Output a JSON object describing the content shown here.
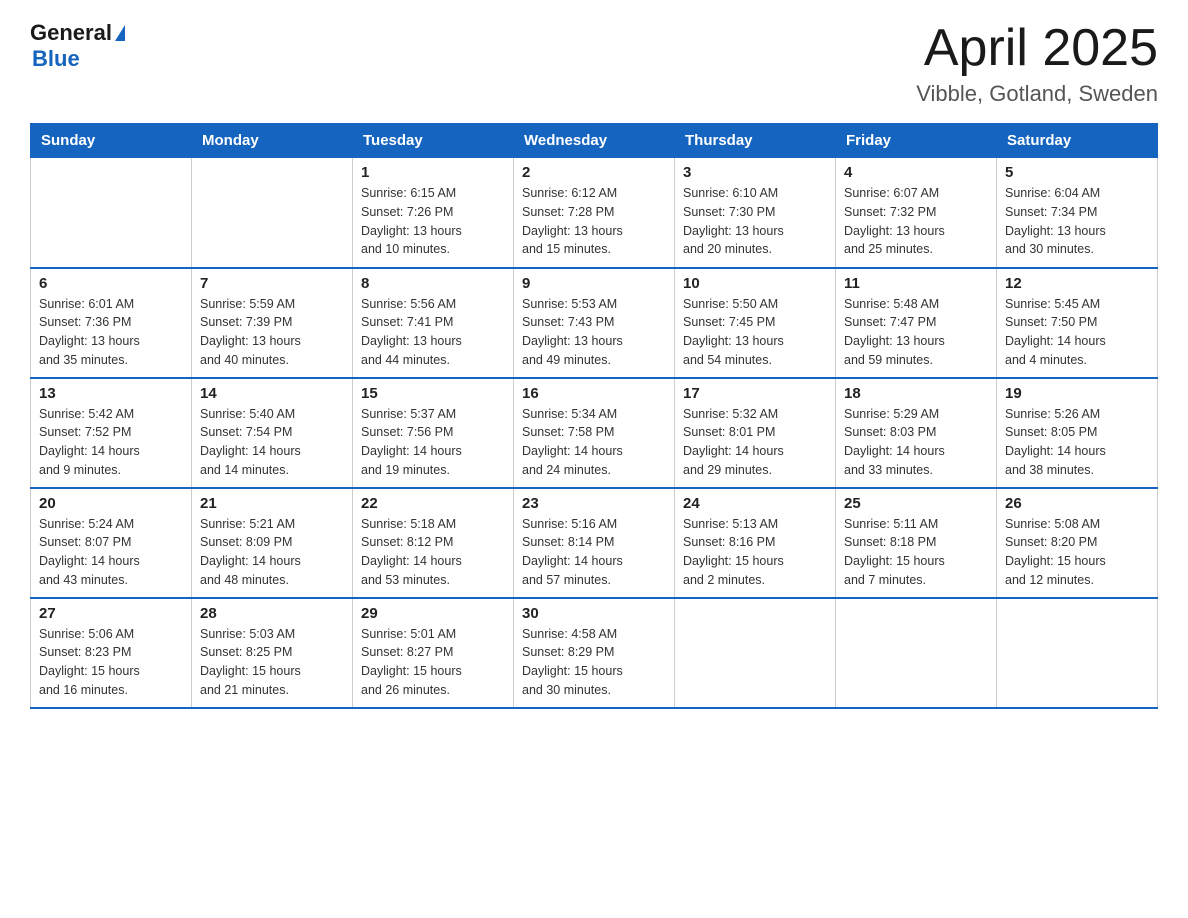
{
  "header": {
    "logo_general": "General",
    "logo_blue": "Blue",
    "title": "April 2025",
    "location": "Vibble, Gotland, Sweden"
  },
  "days_of_week": [
    "Sunday",
    "Monday",
    "Tuesday",
    "Wednesday",
    "Thursday",
    "Friday",
    "Saturday"
  ],
  "weeks": [
    [
      {
        "day": "",
        "info": ""
      },
      {
        "day": "",
        "info": ""
      },
      {
        "day": "1",
        "info": "Sunrise: 6:15 AM\nSunset: 7:26 PM\nDaylight: 13 hours\nand 10 minutes."
      },
      {
        "day": "2",
        "info": "Sunrise: 6:12 AM\nSunset: 7:28 PM\nDaylight: 13 hours\nand 15 minutes."
      },
      {
        "day": "3",
        "info": "Sunrise: 6:10 AM\nSunset: 7:30 PM\nDaylight: 13 hours\nand 20 minutes."
      },
      {
        "day": "4",
        "info": "Sunrise: 6:07 AM\nSunset: 7:32 PM\nDaylight: 13 hours\nand 25 minutes."
      },
      {
        "day": "5",
        "info": "Sunrise: 6:04 AM\nSunset: 7:34 PM\nDaylight: 13 hours\nand 30 minutes."
      }
    ],
    [
      {
        "day": "6",
        "info": "Sunrise: 6:01 AM\nSunset: 7:36 PM\nDaylight: 13 hours\nand 35 minutes."
      },
      {
        "day": "7",
        "info": "Sunrise: 5:59 AM\nSunset: 7:39 PM\nDaylight: 13 hours\nand 40 minutes."
      },
      {
        "day": "8",
        "info": "Sunrise: 5:56 AM\nSunset: 7:41 PM\nDaylight: 13 hours\nand 44 minutes."
      },
      {
        "day": "9",
        "info": "Sunrise: 5:53 AM\nSunset: 7:43 PM\nDaylight: 13 hours\nand 49 minutes."
      },
      {
        "day": "10",
        "info": "Sunrise: 5:50 AM\nSunset: 7:45 PM\nDaylight: 13 hours\nand 54 minutes."
      },
      {
        "day": "11",
        "info": "Sunrise: 5:48 AM\nSunset: 7:47 PM\nDaylight: 13 hours\nand 59 minutes."
      },
      {
        "day": "12",
        "info": "Sunrise: 5:45 AM\nSunset: 7:50 PM\nDaylight: 14 hours\nand 4 minutes."
      }
    ],
    [
      {
        "day": "13",
        "info": "Sunrise: 5:42 AM\nSunset: 7:52 PM\nDaylight: 14 hours\nand 9 minutes."
      },
      {
        "day": "14",
        "info": "Sunrise: 5:40 AM\nSunset: 7:54 PM\nDaylight: 14 hours\nand 14 minutes."
      },
      {
        "day": "15",
        "info": "Sunrise: 5:37 AM\nSunset: 7:56 PM\nDaylight: 14 hours\nand 19 minutes."
      },
      {
        "day": "16",
        "info": "Sunrise: 5:34 AM\nSunset: 7:58 PM\nDaylight: 14 hours\nand 24 minutes."
      },
      {
        "day": "17",
        "info": "Sunrise: 5:32 AM\nSunset: 8:01 PM\nDaylight: 14 hours\nand 29 minutes."
      },
      {
        "day": "18",
        "info": "Sunrise: 5:29 AM\nSunset: 8:03 PM\nDaylight: 14 hours\nand 33 minutes."
      },
      {
        "day": "19",
        "info": "Sunrise: 5:26 AM\nSunset: 8:05 PM\nDaylight: 14 hours\nand 38 minutes."
      }
    ],
    [
      {
        "day": "20",
        "info": "Sunrise: 5:24 AM\nSunset: 8:07 PM\nDaylight: 14 hours\nand 43 minutes."
      },
      {
        "day": "21",
        "info": "Sunrise: 5:21 AM\nSunset: 8:09 PM\nDaylight: 14 hours\nand 48 minutes."
      },
      {
        "day": "22",
        "info": "Sunrise: 5:18 AM\nSunset: 8:12 PM\nDaylight: 14 hours\nand 53 minutes."
      },
      {
        "day": "23",
        "info": "Sunrise: 5:16 AM\nSunset: 8:14 PM\nDaylight: 14 hours\nand 57 minutes."
      },
      {
        "day": "24",
        "info": "Sunrise: 5:13 AM\nSunset: 8:16 PM\nDaylight: 15 hours\nand 2 minutes."
      },
      {
        "day": "25",
        "info": "Sunrise: 5:11 AM\nSunset: 8:18 PM\nDaylight: 15 hours\nand 7 minutes."
      },
      {
        "day": "26",
        "info": "Sunrise: 5:08 AM\nSunset: 8:20 PM\nDaylight: 15 hours\nand 12 minutes."
      }
    ],
    [
      {
        "day": "27",
        "info": "Sunrise: 5:06 AM\nSunset: 8:23 PM\nDaylight: 15 hours\nand 16 minutes."
      },
      {
        "day": "28",
        "info": "Sunrise: 5:03 AM\nSunset: 8:25 PM\nDaylight: 15 hours\nand 21 minutes."
      },
      {
        "day": "29",
        "info": "Sunrise: 5:01 AM\nSunset: 8:27 PM\nDaylight: 15 hours\nand 26 minutes."
      },
      {
        "day": "30",
        "info": "Sunrise: 4:58 AM\nSunset: 8:29 PM\nDaylight: 15 hours\nand 30 minutes."
      },
      {
        "day": "",
        "info": ""
      },
      {
        "day": "",
        "info": ""
      },
      {
        "day": "",
        "info": ""
      }
    ]
  ]
}
